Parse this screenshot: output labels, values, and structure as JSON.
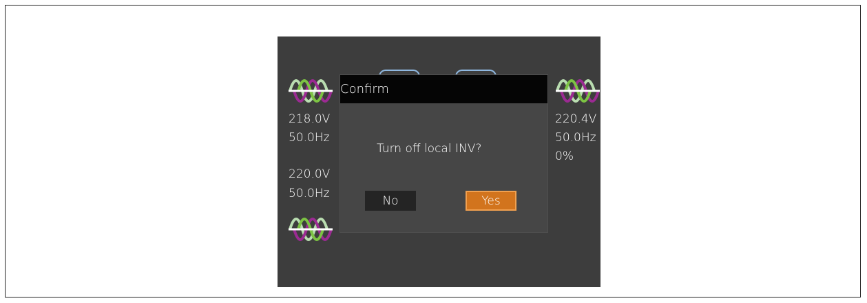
{
  "left_panel": {
    "bypass_voltage": "218.0V",
    "bypass_frequency": "50.0Hz",
    "mains_voltage": "220.0V",
    "mains_frequency": "50.0Hz"
  },
  "right_panel": {
    "output_voltage": "220.4V",
    "output_frequency": "50.0Hz",
    "load_percent": "0%"
  },
  "dialog": {
    "title": "Confirm",
    "message": "Turn off local INV?",
    "no_label": "No",
    "yes_label": "Yes"
  },
  "colors": {
    "screen_bg": "#3d3d3d",
    "dialog_bg": "#464646",
    "titlebar_bg": "#050505",
    "yes_button": "#d2741d",
    "wave_green": "#7cc243",
    "wave_purple": "#9b2a92",
    "wave_light": "#b9ddb0"
  },
  "icons": {
    "sine_wave": "ac-sine-wave-icon"
  }
}
